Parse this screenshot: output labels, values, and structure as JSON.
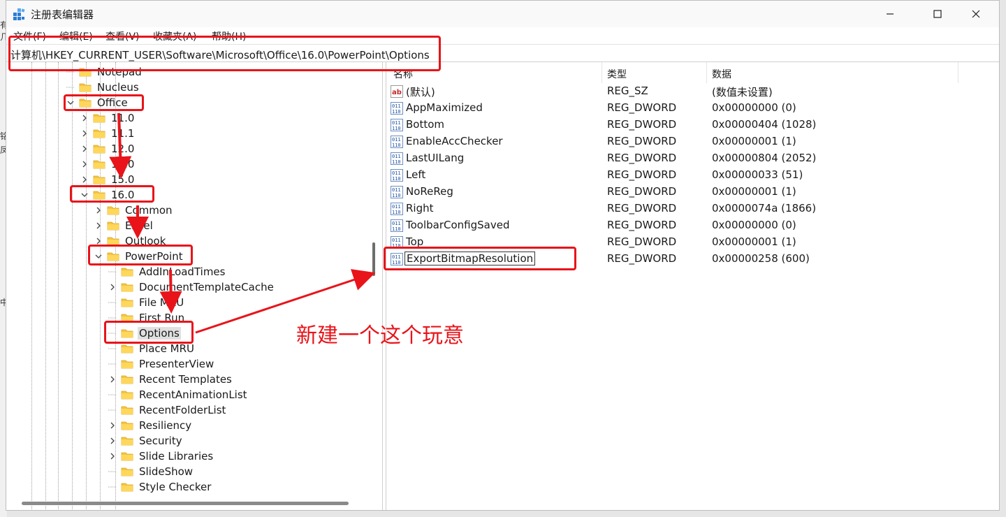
{
  "window": {
    "title": "注册表编辑器",
    "icons": [
      "regedit-icon",
      "minimize-icon",
      "maximize-icon",
      "close-icon"
    ]
  },
  "background": {
    "text1": "有几",
    "text2": "铭",
    "text3": "凤",
    "text4": "中"
  },
  "menu": [
    "文件(F)",
    "编辑(E)",
    "查看(V)",
    "收藏夹(A)",
    "帮助(H)"
  ],
  "address": "计算机\\HKEY_CURRENT_USER\\Software\\Microsoft\\Office\\16.0\\PowerPoint\\Options",
  "tree": [
    {
      "label": "Notepad",
      "depth": 0,
      "chevron": "none"
    },
    {
      "label": "Nucleus",
      "depth": 0,
      "chevron": "none"
    },
    {
      "label": "Office",
      "depth": 0,
      "chevron": "expanded"
    },
    {
      "label": "11.0",
      "depth": 1,
      "chevron": "collapsed"
    },
    {
      "label": "11.1",
      "depth": 1,
      "chevron": "collapsed"
    },
    {
      "label": "12.0",
      "depth": 1,
      "chevron": "collapsed"
    },
    {
      "label": "14.0",
      "depth": 1,
      "chevron": "collapsed"
    },
    {
      "label": "15.0",
      "depth": 1,
      "chevron": "collapsed"
    },
    {
      "label": "16.0",
      "depth": 1,
      "chevron": "expanded"
    },
    {
      "label": "Common",
      "depth": 2,
      "chevron": "collapsed"
    },
    {
      "label": "Excel",
      "depth": 2,
      "chevron": "collapsed"
    },
    {
      "label": "Outlook",
      "depth": 2,
      "chevron": "collapsed"
    },
    {
      "label": "PowerPoint",
      "depth": 2,
      "chevron": "expanded"
    },
    {
      "label": "AddInLoadTimes",
      "depth": 3,
      "chevron": "none"
    },
    {
      "label": "DocumentTemplateCache",
      "depth": 3,
      "chevron": "collapsed"
    },
    {
      "label": "File MRU",
      "depth": 3,
      "chevron": "none"
    },
    {
      "label": "First Run",
      "depth": 3,
      "chevron": "none"
    },
    {
      "label": "Options",
      "depth": 3,
      "chevron": "none",
      "selected": true
    },
    {
      "label": "Place MRU",
      "depth": 3,
      "chevron": "none"
    },
    {
      "label": "PresenterView",
      "depth": 3,
      "chevron": "none"
    },
    {
      "label": "Recent Templates",
      "depth": 3,
      "chevron": "collapsed"
    },
    {
      "label": "RecentAnimationList",
      "depth": 3,
      "chevron": "none"
    },
    {
      "label": "RecentFolderList",
      "depth": 3,
      "chevron": "none"
    },
    {
      "label": "Resiliency",
      "depth": 3,
      "chevron": "collapsed"
    },
    {
      "label": "Security",
      "depth": 3,
      "chevron": "collapsed"
    },
    {
      "label": "Slide Libraries",
      "depth": 3,
      "chevron": "collapsed"
    },
    {
      "label": "SlideShow",
      "depth": 3,
      "chevron": "none"
    },
    {
      "label": "Style Checker",
      "depth": 3,
      "chevron": "none"
    }
  ],
  "columns": {
    "name": "名称",
    "type": "类型",
    "data": "数据"
  },
  "values": [
    {
      "icon": "string-value-icon",
      "name": "(默认)",
      "type": "REG_SZ",
      "data": "(数值未设置)"
    },
    {
      "icon": "dword-value-icon",
      "name": "AppMaximized",
      "type": "REG_DWORD",
      "data": "0x00000000 (0)"
    },
    {
      "icon": "dword-value-icon",
      "name": "Bottom",
      "type": "REG_DWORD",
      "data": "0x00000404 (1028)"
    },
    {
      "icon": "dword-value-icon",
      "name": "EnableAccChecker",
      "type": "REG_DWORD",
      "data": "0x00000001 (1)"
    },
    {
      "icon": "dword-value-icon",
      "name": "LastUILang",
      "type": "REG_DWORD",
      "data": "0x00000804 (2052)"
    },
    {
      "icon": "dword-value-icon",
      "name": "Left",
      "type": "REG_DWORD",
      "data": "0x00000033 (51)"
    },
    {
      "icon": "dword-value-icon",
      "name": "NoReReg",
      "type": "REG_DWORD",
      "data": "0x00000001 (1)"
    },
    {
      "icon": "dword-value-icon",
      "name": "Right",
      "type": "REG_DWORD",
      "data": "0x0000074a (1866)"
    },
    {
      "icon": "dword-value-icon",
      "name": "ToolbarConfigSaved",
      "type": "REG_DWORD",
      "data": "0x00000000 (0)"
    },
    {
      "icon": "dword-value-icon",
      "name": "Top",
      "type": "REG_DWORD",
      "data": "0x00000001 (1)"
    },
    {
      "icon": "dword-value-icon",
      "name": "ExportBitmapResolution",
      "type": "REG_DWORD",
      "data": "0x00000258 (600)",
      "editing": true
    }
  ],
  "annotation": {
    "text": "新建一个这个玩意",
    "color": "#e8141a"
  }
}
